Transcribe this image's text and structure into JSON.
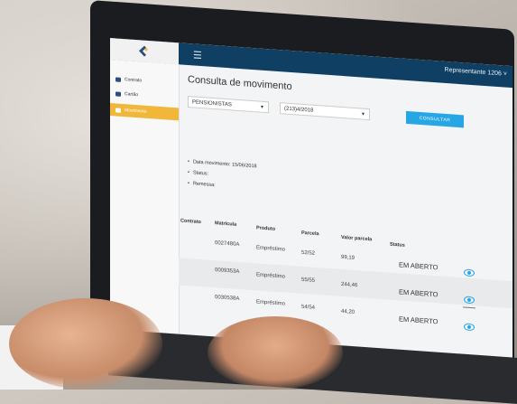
{
  "header": {
    "user_label": "Representante 1206 ˅"
  },
  "sidebar": {
    "items": [
      {
        "label": "Contrato"
      },
      {
        "label": "Cartão"
      },
      {
        "label": "Movimento"
      }
    ]
  },
  "main": {
    "title": "Consulta de movimento",
    "filter1": "PENSIONISTAS",
    "filter2": "(213)4/2018",
    "button": "CONSULTAR",
    "info": [
      "Data movimento: 15/06/2018",
      "Status:",
      "Remessa:"
    ],
    "columns": [
      "Contrato",
      "Matrícula",
      "Produto",
      "Parcela",
      "Valor parcela",
      "Status"
    ],
    "rows": [
      {
        "matricula": "0027480A",
        "produto": "Empréstimo",
        "parcela": "52/52",
        "valor": "99,19",
        "status": "EM ABERTO"
      },
      {
        "matricula": "0009353A",
        "produto": "Empréstimo",
        "parcela": "55/55",
        "valor": "244,46",
        "status": "EM ABERTO"
      },
      {
        "matricula": "0030538A",
        "produto": "Empréstimo",
        "parcela": "54/54",
        "valor": "44,20",
        "status": "EM ABERTO"
      }
    ]
  },
  "colors": {
    "topbar": "#0f3f63",
    "accent": "#27a6e5",
    "active": "#f1b73a"
  }
}
